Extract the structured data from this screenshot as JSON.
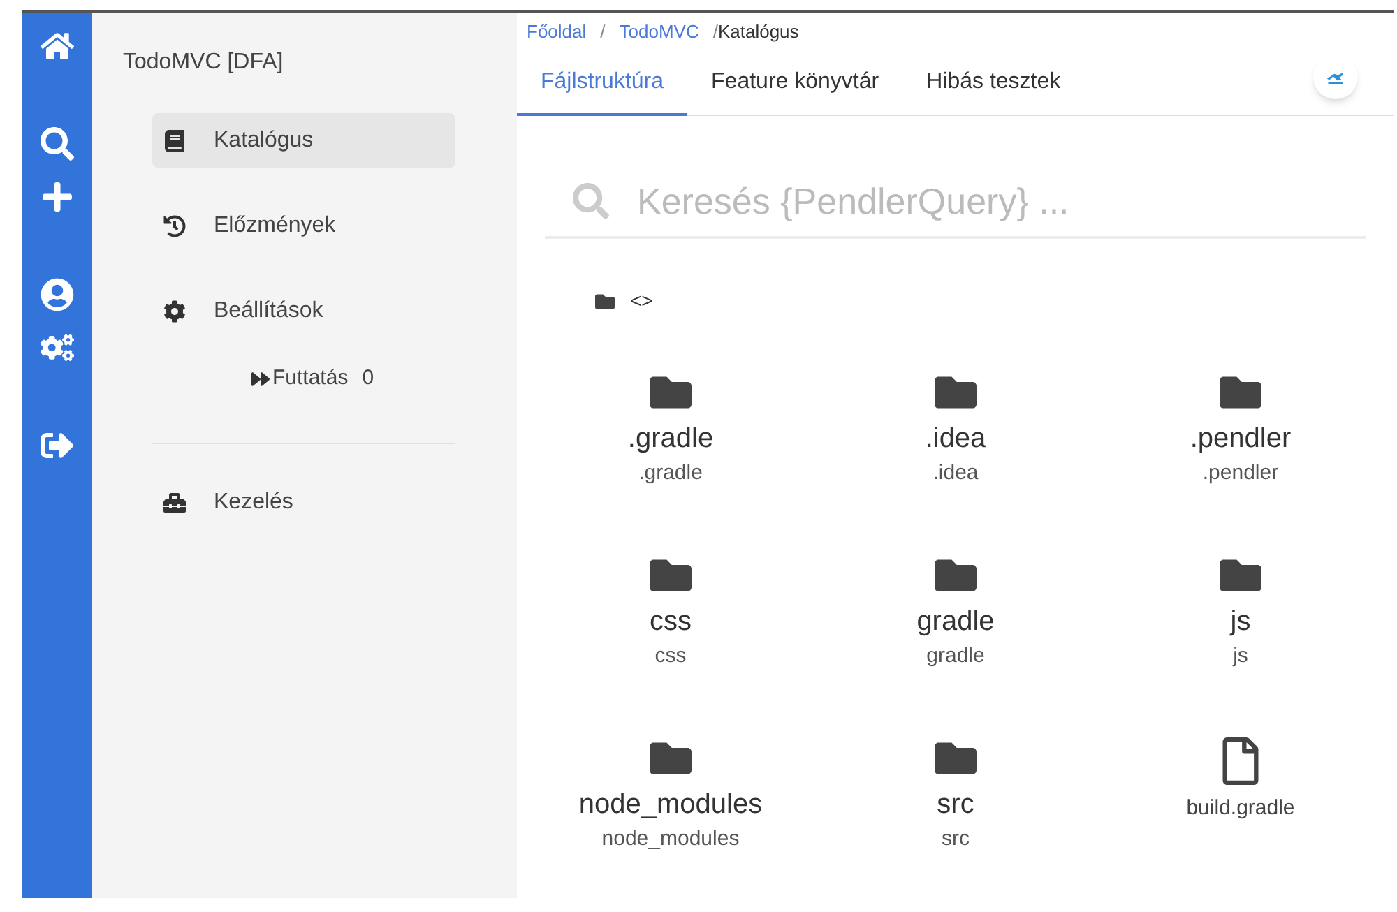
{
  "rail": {
    "items": [
      {
        "kind": "home"
      },
      {
        "kind": "search"
      },
      {
        "kind": "add"
      },
      {
        "kind": "user"
      },
      {
        "kind": "cogs"
      },
      {
        "kind": "logout"
      }
    ]
  },
  "sidebar": {
    "title": "TodoMVC [DFA]",
    "items": [
      {
        "kind": "book",
        "label": "Katalógus",
        "selected": true
      },
      {
        "kind": "history",
        "label": "Előzmények",
        "selected": false
      },
      {
        "kind": "gear",
        "label": "Beállítások",
        "selected": false
      }
    ],
    "run": {
      "label": "Futtatás",
      "count": "0"
    },
    "bottom_items": [
      {
        "kind": "toolbox",
        "label": "Kezelés",
        "selected": false
      }
    ]
  },
  "breadcrumb": [
    {
      "kind": "link",
      "label": "Főoldal"
    },
    {
      "kind": "separator",
      "label": "/"
    },
    {
      "kind": "link",
      "label": "TodoMVC"
    },
    {
      "kind": "separator",
      "label": "/"
    },
    {
      "kind": "current",
      "label": "Katalógus"
    }
  ],
  "tabs": [
    {
      "label": "Fájlstruktúra",
      "selected": true
    },
    {
      "label": "Feature könyvtár",
      "selected": false
    },
    {
      "label": "Hibás tesztek",
      "selected": false
    }
  ],
  "search": {
    "placeholder": "Keresés {PendlerQuery} ..."
  },
  "path": {
    "label": "<>"
  },
  "files": [
    {
      "kind": "folder",
      "name": ".gradle",
      "path": ".gradle"
    },
    {
      "kind": "folder",
      "name": ".idea",
      "path": ".idea"
    },
    {
      "kind": "folder",
      "name": ".pendler",
      "path": ".pendler"
    },
    {
      "kind": "folder",
      "name": "css",
      "path": "css"
    },
    {
      "kind": "folder",
      "name": "gradle",
      "path": "gradle"
    },
    {
      "kind": "folder",
      "name": "js",
      "path": "js"
    },
    {
      "kind": "folder",
      "name": "node_modules",
      "path": "node_modules"
    },
    {
      "kind": "folder",
      "name": "src",
      "path": "src"
    },
    {
      "kind": "file",
      "name": "build.gradle"
    }
  ]
}
